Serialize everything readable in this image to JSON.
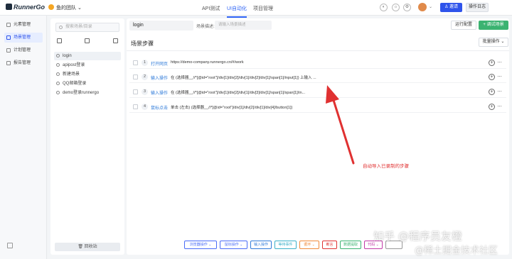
{
  "app": {
    "logo": "RunnerGo",
    "team": "鱼的团队"
  },
  "top_nav": {
    "tabs": [
      "API测试",
      "UI自动化",
      "项目管理"
    ],
    "active": "UI自动化"
  },
  "header": {
    "invite_label": "邀请",
    "log_label": "操作日志"
  },
  "left_nav": {
    "items": [
      {
        "label": "元素管理",
        "icon": "element-icon"
      },
      {
        "label": "场景管理",
        "icon": "scene-icon"
      },
      {
        "label": "计划管理",
        "icon": "plan-icon"
      },
      {
        "label": "报告管理",
        "icon": "report-icon"
      }
    ],
    "active": "场景管理"
  },
  "tree": {
    "search_placeholder": "搜索场景/目录",
    "items": [
      "login",
      "apipost登录",
      "新建场景",
      "QQ邮箱登录",
      "demo登录runnergo"
    ],
    "active": "login",
    "recycle_label": "回收站"
  },
  "main": {
    "scene_name": "login",
    "desc_label": "场景描述:",
    "desc_placeholder": "请输入场景描述",
    "run_config_label": "运行配置",
    "debug_label": "+ 调试场景",
    "section_title": "场景步骤",
    "batch_label": "批量操作"
  },
  "steps": [
    {
      "num": "1",
      "type": "打开网页",
      "content": "https://demo-company.runnergo.cn/#/work"
    },
    {
      "num": "2",
      "type": "输入操作",
      "content": "在 (选择器__//*[@id=\"root\"]/div[1]/div[2]/div[1]/div[2]/div[1]/span[1]/input[1]) 上输入 ..."
    },
    {
      "num": "3",
      "type": "输入操作",
      "content": "在 (选择器__//*[@id=\"root\"]/div[1]/div[2]/div[1]/div[3]/div[1]/span[1]/span[1]/in..."
    },
    {
      "num": "4",
      "type": "鼠标点击",
      "content": "单击 (左击) (选择器__//*[@id=\"root\"]/div[1]/div[2]/div[1]/div[4]/button[1])"
    }
  ],
  "annotation": "自动导入已录制的步骤",
  "toolbar": [
    {
      "label": "浏览器操作",
      "color": "#4a6cf7"
    },
    {
      "label": "鼠标操作",
      "color": "#4a6cf7"
    },
    {
      "label": "输入操作",
      "color": "#2f7bd9"
    },
    {
      "label": "等待事件",
      "color": "#3bb0c9"
    },
    {
      "label": "循环",
      "color": "#f08a3b"
    },
    {
      "label": "断言",
      "color": "#e03131"
    },
    {
      "label": "数据提取",
      "color": "#3bb371"
    },
    {
      "label": "代码",
      "color": "#c23aa8"
    },
    {
      "label": "",
      "color": "#999999"
    }
  ],
  "watermark": {
    "line1": "知乎 @程序员友橙",
    "line2": "@稀土掘金技术社区"
  },
  "colors": {
    "accent": "#2f54eb",
    "success": "#3bb371",
    "annotation": "#e03131"
  }
}
